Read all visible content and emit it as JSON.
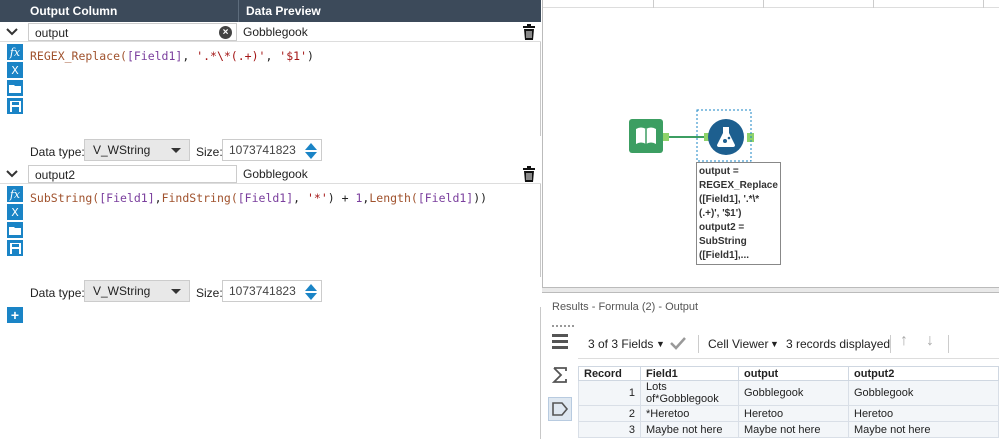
{
  "header": {
    "col1": "Output Column",
    "col2": "Data Preview"
  },
  "fields": [
    {
      "name": "output",
      "preview": "Gobblegook",
      "expr": {
        "fn": "REGEX_Replace(",
        "field": "[Field1]",
        "mid": ", ",
        "arg1": "'.*\\*(.+)'",
        "sep": ", ",
        "arg2": "'$1'",
        "end": ")"
      },
      "data_type_label": "Data type:",
      "data_type": "V_WString",
      "size_label": "Size:",
      "size": "1073741823"
    },
    {
      "name": "output2",
      "preview": "Gobblegook",
      "expr": {
        "a": "SubString(",
        "b": "[Field1]",
        "c": ",",
        "d": "FindString(",
        "e": "[Field1]",
        "f": ", ",
        "g": "'*'",
        "h": ") + ",
        "i": "1",
        "j": ",",
        "k": "Length(",
        "l": "[Field1]",
        "m": "))"
      },
      "data_type_label": "Data type:",
      "data_type": "V_WString",
      "size_label": "Size:",
      "size": "1073741823"
    }
  ],
  "tool_icons": [
    "fx-icon",
    "variable-icon",
    "folder-icon",
    "save-icon"
  ],
  "canvas": {
    "annotation_lines": [
      "output =",
      "REGEX_Replace",
      "([Field1], '.*\\*",
      "(.+)', '$1')",
      "output2 =",
      "SubString",
      "([Field1],..."
    ]
  },
  "results": {
    "title": "Results - Formula (2) - Output",
    "fields_label": "3 of 3 Fields",
    "cell_viewer": "Cell Viewer",
    "records": "3 records displayed",
    "columns": [
      "Record",
      "Field1",
      "output",
      "output2"
    ],
    "rows": [
      [
        "1",
        "Lots of*Gobblegook",
        "Gobblegook",
        "Gobblegook"
      ],
      [
        "2",
        "*Heretoo",
        "Heretoo",
        "Heretoo"
      ],
      [
        "3",
        "Maybe not here",
        "Maybe not here",
        "Maybe not here"
      ]
    ]
  },
  "colors": {
    "accent": "#1a84c6",
    "header": "#3c4a5a",
    "tool_green": "#3c9e62",
    "tool_blue": "#1d5f8f"
  }
}
